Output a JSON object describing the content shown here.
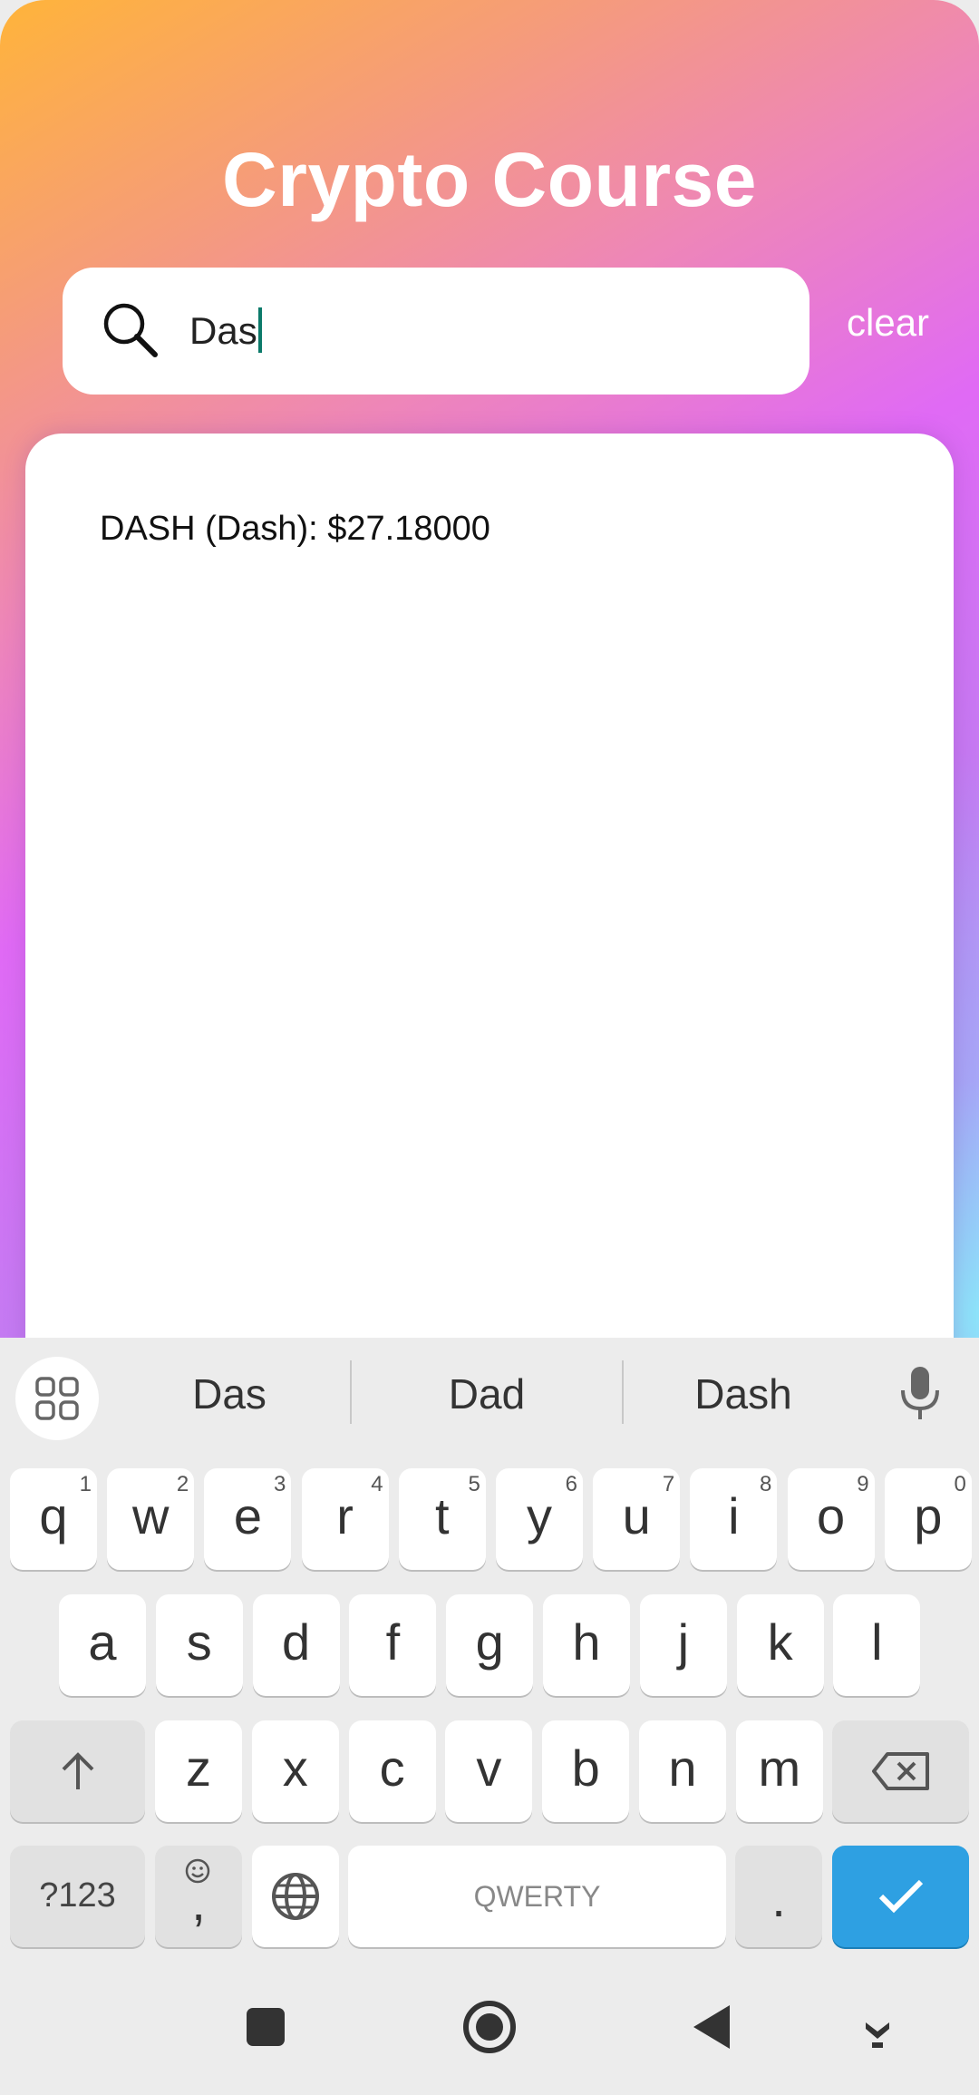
{
  "app": {
    "title": "Crypto Course"
  },
  "search": {
    "value": "Das",
    "clear_label": "clear"
  },
  "results": [
    {
      "text": "DASH (Dash): $27.18000"
    }
  ],
  "keyboard": {
    "suggestions": [
      "Das",
      "Dad",
      "Dash"
    ],
    "row1": [
      {
        "k": "q",
        "h": "1"
      },
      {
        "k": "w",
        "h": "2"
      },
      {
        "k": "e",
        "h": "3"
      },
      {
        "k": "r",
        "h": "4"
      },
      {
        "k": "t",
        "h": "5"
      },
      {
        "k": "y",
        "h": "6"
      },
      {
        "k": "u",
        "h": "7"
      },
      {
        "k": "i",
        "h": "8"
      },
      {
        "k": "o",
        "h": "9"
      },
      {
        "k": "p",
        "h": "0"
      }
    ],
    "row2": [
      "a",
      "s",
      "d",
      "f",
      "g",
      "h",
      "j",
      "k",
      "l"
    ],
    "row3": [
      "z",
      "x",
      "c",
      "v",
      "b",
      "n",
      "m"
    ],
    "symbols_label": "?123",
    "comma_label": ",",
    "space_label": "QWERTY",
    "period_label": "."
  },
  "colors": {
    "gradient_start": "#ffb43a",
    "gradient_mid": "#e06af5",
    "gradient_end": "#8ce6fa",
    "enter": "#2ea0e2",
    "caret": "#0c7a6a"
  }
}
